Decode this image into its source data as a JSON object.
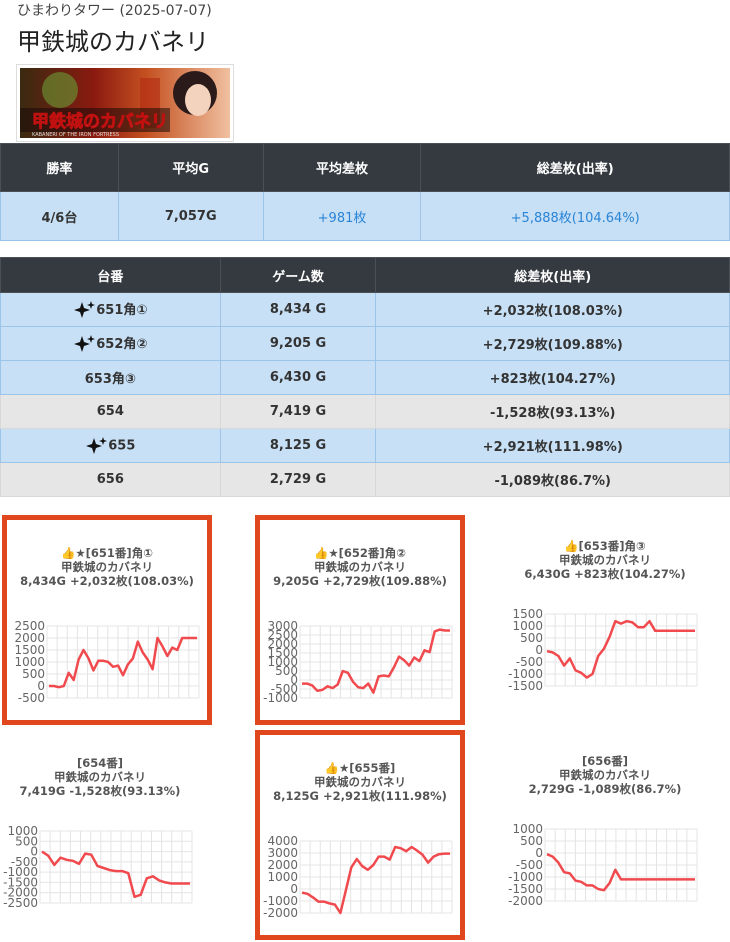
{
  "header": {
    "subtitle": "ひまわりタワー (2025-07-07)",
    "title": "甲鉄城のカバネリ"
  },
  "banner": {
    "alt_text": "甲鉄城のカバネリ",
    "sub_text": "KABANERI OF THE IRON FORTRESS"
  },
  "summary": {
    "headers": [
      "勝率",
      "平均G",
      "平均差枚",
      "総差枚(出率)"
    ],
    "values": [
      "4/6台",
      "7,057G",
      "+981枚",
      "+5,888枚(104.64%)"
    ]
  },
  "machines": {
    "headers": [
      "台番",
      "ゲーム数",
      "総差枚(出率)"
    ],
    "rows": [
      {
        "id": "651角①",
        "games": "8,434 G",
        "diff": "+2,032枚(108.03%)",
        "sparkle": true,
        "style": "blue"
      },
      {
        "id": "652角②",
        "games": "9,205 G",
        "diff": "+2,729枚(109.88%)",
        "sparkle": true,
        "style": "blue"
      },
      {
        "id": "653角③",
        "games": "6,430 G",
        "diff": "+823枚(104.27%)",
        "sparkle": false,
        "style": "blue"
      },
      {
        "id": "654",
        "games": "7,419 G",
        "diff": "-1,528枚(93.13%)",
        "sparkle": false,
        "style": "gray"
      },
      {
        "id": "655",
        "games": "8,125 G",
        "diff": "+2,921枚(111.98%)",
        "sparkle": true,
        "style": "blue"
      },
      {
        "id": "656",
        "games": "2,729 G",
        "diff": "-1,089枚(86.7%)",
        "sparkle": false,
        "style": "gray"
      }
    ]
  },
  "chart_data": [
    {
      "type": "line",
      "title1": "👍★[651番]角①",
      "title2": "甲鉄城のカバネリ",
      "title3": "8,434G +2,032枚(108.03%)",
      "highlight": true,
      "ylim": [
        -500,
        2500
      ],
      "ticks": [
        2500,
        2000,
        1500,
        1000,
        500,
        0,
        -500
      ],
      "values": [
        0,
        0,
        -50,
        0,
        550,
        250,
        1100,
        1500,
        1150,
        650,
        1050,
        1050,
        1000,
        800,
        850,
        450,
        900,
        1150,
        1850,
        1400,
        1100,
        700,
        2000,
        1650,
        1250,
        1600,
        1500,
        2000,
        2000,
        2000,
        2000
      ]
    },
    {
      "type": "line",
      "title1": "👍★[652番]角②",
      "title2": "甲鉄城のカバネリ",
      "title3": "9,205G +2,729枚(109.88%)",
      "highlight": true,
      "ylim": [
        -1000,
        3000
      ],
      "ticks": [
        3000,
        2500,
        2000,
        1500,
        1000,
        500,
        0,
        -500,
        -1000
      ],
      "values": [
        -200,
        -200,
        -300,
        -600,
        -550,
        -350,
        -450,
        -250,
        500,
        400,
        -100,
        -400,
        -450,
        -200,
        -700,
        200,
        250,
        200,
        700,
        1300,
        1100,
        800,
        1250,
        1050,
        1650,
        1550,
        2700,
        2800,
        2750,
        2750
      ]
    },
    {
      "type": "line",
      "title1": "👍[653番]角③",
      "title2": "甲鉄城のカバネリ",
      "title3": "6,430G +823枚(104.27%)",
      "highlight": false,
      "ylim": [
        -1500,
        1500
      ],
      "ticks": [
        1500,
        1000,
        500,
        0,
        -500,
        -1000,
        -1500
      ],
      "values": [
        -50,
        -100,
        -250,
        -650,
        -350,
        -850,
        -950,
        -1150,
        -1000,
        -250,
        50,
        550,
        1200,
        1100,
        1200,
        1150,
        950,
        950,
        1200,
        800,
        800,
        800,
        800,
        800,
        800,
        800,
        800
      ]
    },
    {
      "type": "line",
      "title1": "[654番]",
      "title2": "甲鉄城のカバネリ",
      "title3": "7,419G -1,528枚(93.13%)",
      "highlight": false,
      "ylim": [
        -2500,
        1000
      ],
      "ticks": [
        1000,
        500,
        0,
        -500,
        -1000,
        -1500,
        -2000,
        -2500
      ],
      "values": [
        0,
        -200,
        -650,
        -300,
        -400,
        -450,
        -600,
        -100,
        -150,
        -700,
        -800,
        -900,
        -950,
        -950,
        -1050,
        -2200,
        -2100,
        -1300,
        -1200,
        -1400,
        -1500,
        -1550,
        -1550,
        -1550,
        -1550
      ]
    },
    {
      "type": "line",
      "title1": "👍★[655番]",
      "title2": "甲鉄城のカバネリ",
      "title3": "8,125G +2,921枚(111.98%)",
      "highlight": true,
      "ylim": [
        -2000,
        4000
      ],
      "ticks": [
        4000,
        3000,
        2000,
        1000,
        0,
        -1000,
        -2000
      ],
      "values": [
        -300,
        -400,
        -700,
        -1050,
        -1050,
        -1200,
        -1300,
        -2000,
        -100,
        1800,
        2500,
        1900,
        1600,
        2000,
        2700,
        2700,
        2450,
        3500,
        3400,
        3150,
        3500,
        3200,
        2850,
        2200,
        2700,
        2900,
        2950,
        2950
      ]
    },
    {
      "type": "line",
      "title1": "[656番]",
      "title2": "甲鉄城のカバネリ",
      "title3": "2,729G -1,089枚(86.7%)",
      "highlight": false,
      "ylim": [
        -2000,
        1000
      ],
      "ticks": [
        1000,
        500,
        0,
        -500,
        -1000,
        -1500,
        -2000
      ],
      "values": [
        -50,
        -150,
        -400,
        -800,
        -850,
        -1150,
        -1200,
        -1350,
        -1350,
        -1500,
        -1550,
        -1250,
        -700,
        -1100,
        -1100,
        -1100,
        -1100,
        -1100,
        -1100,
        -1100,
        -1100,
        -1100,
        -1100,
        -1100,
        -1100,
        -1100,
        -1100
      ]
    }
  ],
  "colors": {
    "line": "#f04a4e",
    "highlight_border": "#e0471c",
    "header_bg": "#343a40",
    "row_blue": "#c7e0f6",
    "row_gray": "#e6e6e6",
    "link_blue": "#2a84d6"
  }
}
